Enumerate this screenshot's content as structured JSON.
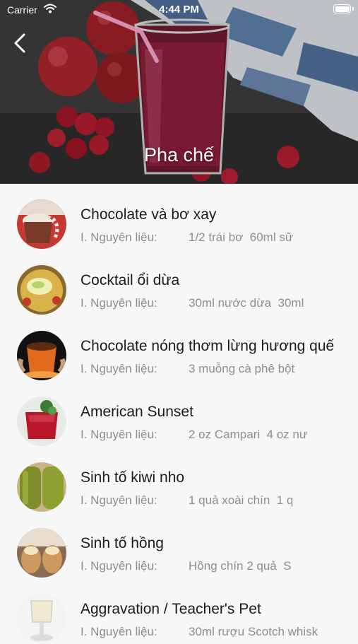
{
  "status_bar": {
    "carrier": "Carrier",
    "time": "4:44 PM"
  },
  "header": {
    "title": "Pha chế"
  },
  "ingredient_label": "I. Nguyên liệu:",
  "items": [
    {
      "title": "Chocolate và bơ xay",
      "ingredients": "1/2 trái bơ  60ml sữ"
    },
    {
      "title": "Cocktail ổi dừa",
      "ingredients": "30ml nước dừa  30ml"
    },
    {
      "title": "Chocolate nóng thơm lừng hương quế",
      "ingredients": "3 muỗng cà phê bột"
    },
    {
      "title": "American Sunset",
      "ingredients": "2 oz Campari  4 oz nư"
    },
    {
      "title": "Sinh tố kiwi nho",
      "ingredients": "1 quả xoài chín  1 q"
    },
    {
      "title": "Sinh tố hồng",
      "ingredients": "Hồng chín 2 quả  S"
    },
    {
      "title": "Aggravation / Teacher's Pet",
      "ingredients": "30ml rượu Scotch whisk"
    }
  ]
}
